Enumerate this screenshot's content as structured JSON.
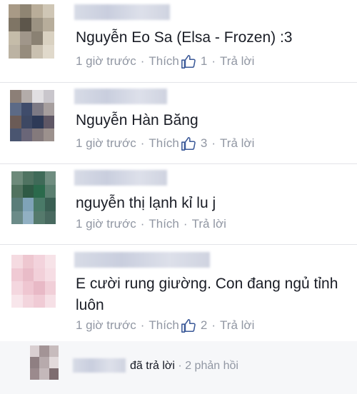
{
  "comments": [
    {
      "text": "Nguyễn Eo Sa (Elsa - Frozen) :3",
      "time": "1 giờ trước",
      "like_label": "Thích",
      "like_count": "1",
      "reply_label": "Trả lời",
      "avatar_colors": [
        "#a89a86",
        "#8f8573",
        "#b9ad99",
        "#cfc6b5",
        "#7f7565",
        "#5d564b",
        "#9b9282",
        "#b7ad9b",
        "#c5bca9",
        "#a0968a",
        "#8a8173",
        "#d9d1c1",
        "#bcb3a3",
        "#968c7d",
        "#c9c0b0",
        "#e0d9cb"
      ]
    },
    {
      "text": "Nguyễn Hàn Băng",
      "time": "1 giờ trước",
      "like_label": "Thích",
      "like_count": "3",
      "reply_label": "Trả lời",
      "avatar_colors": [
        "#8c7f77",
        "#b3aca9",
        "#e1dfe2",
        "#c9c6cc",
        "#5c6a86",
        "#3f4c6b",
        "#7d7a85",
        "#a69e9e",
        "#6b5b56",
        "#3d4863",
        "#2e3a57",
        "#5f5765",
        "#4a5570",
        "#6a6678",
        "#847a7c",
        "#9c918d"
      ]
    },
    {
      "text": "nguyễn thị lạnh kỉ lu j",
      "time": "1 giờ trước",
      "like_label": "Thích",
      "reply_label": "Trả lời",
      "avatar_colors": [
        "#6d8a7a",
        "#4f7361",
        "#3f6a58",
        "#6f8d80",
        "#51725f",
        "#2f5a45",
        "#2b6a4c",
        "#5b7f70",
        "#5a7d79",
        "#7fa3b8",
        "#4a7a68",
        "#3a5f53",
        "#6b8b88",
        "#91b0c3",
        "#557a6c",
        "#48695f"
      ]
    },
    {
      "text": "E cười rung giường. Con đang ngủ tỉnh luôn",
      "time": "1 giờ trước",
      "like_label": "Thích",
      "like_count": "2",
      "reply_label": "Trả lời",
      "avatar_colors": [
        "#f5dbe1",
        "#eec7d0",
        "#f3d3dc",
        "#f7e3e8",
        "#f0cad4",
        "#e9bcc8",
        "#f2d0d9",
        "#f6dde4",
        "#f4d7df",
        "#efc6d1",
        "#e8b9c6",
        "#f1cfd8",
        "#f8e6eb",
        "#f3d5dd",
        "#f0cbd5",
        "#f6e0e6"
      ]
    }
  ],
  "reply_summary": {
    "action_text": "đã trả lời",
    "count_text": "2 phản hồi",
    "avatar_colors": [
      "#d9cfd1",
      "#a39496",
      "#c7bcbd",
      "#8f7f82",
      "#b7aaac",
      "#e2dadb",
      "#9b8a8d",
      "#c4b8ba",
      "#7e6d70"
    ]
  },
  "colors": {
    "meta_gray": "#9197a3",
    "link_blue": "#3b5998",
    "separator": "#e3e4e8"
  }
}
